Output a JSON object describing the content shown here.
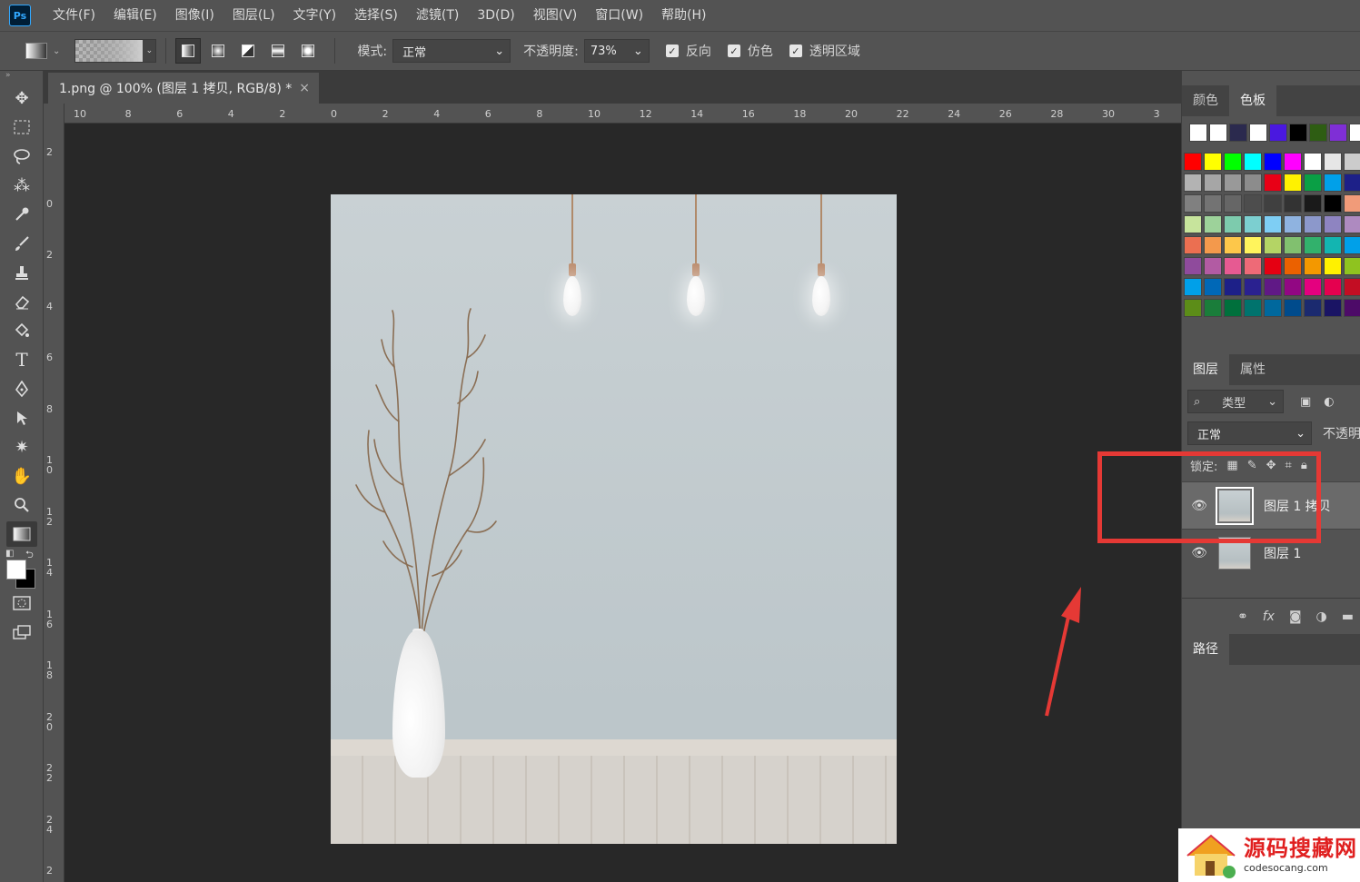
{
  "menubar": {
    "logo": "Ps",
    "items": [
      "文件(F)",
      "编辑(E)",
      "图像(I)",
      "图层(L)",
      "文字(Y)",
      "选择(S)",
      "滤镜(T)",
      "3D(D)",
      "视图(V)",
      "窗口(W)",
      "帮助(H)"
    ]
  },
  "options": {
    "mode_label": "模式:",
    "mode_value": "正常",
    "opacity_label": "不透明度:",
    "opacity_value": "73%",
    "reverse_label": "反向",
    "dither_label": "仿色",
    "transparency_label": "透明区域"
  },
  "document": {
    "tab_title": "1.png @ 100% (图层 1 拷贝, RGB/8) *",
    "close_glyph": "×",
    "h_ruler": [
      "10",
      "8",
      "6",
      "4",
      "2",
      "0",
      "2",
      "4",
      "6",
      "8",
      "10",
      "12",
      "14",
      "16",
      "18",
      "20",
      "22",
      "24",
      "26",
      "28",
      "30",
      "3"
    ],
    "v_ruler": [
      "2",
      "0",
      "2",
      "4",
      "6",
      "8",
      "10",
      "12",
      "14",
      "16",
      "18",
      "20",
      "22",
      "24",
      "2"
    ]
  },
  "swatch_panel": {
    "tabs": [
      "颜色",
      "色板"
    ],
    "active": "色板",
    "rows": [
      [
        "#ffffff",
        "#ffffff",
        "#2b2a4e",
        "#ffffff",
        "#4a18e0",
        "#000000",
        "#2e5d13",
        "#7f2fd6",
        "#ffffff"
      ],
      [
        "#ff0000",
        "#ffff00",
        "#00ff00",
        "#00ffff",
        "#0000ff",
        "#ff00ff",
        "#ffffff",
        "#e6e6e6",
        "#cccccc"
      ],
      [
        "#b3b3b3",
        "#a6a6a6",
        "#999999",
        "#8c8c8c",
        "#e80016",
        "#fff200",
        "#0a9f45",
        "#00a0e9",
        "#1d2088"
      ],
      [
        "#808080",
        "#737373",
        "#666666",
        "#4d4d4d",
        "#404040",
        "#333333",
        "#1a1a1a",
        "#000000",
        "#f19b79"
      ],
      [
        "#c7e49c",
        "#9dd29a",
        "#7dcbad",
        "#7ccfd0",
        "#7ecef4",
        "#8fb3e0",
        "#8c98cb",
        "#8e84c1",
        "#ae8ac0"
      ],
      [
        "#eb6f51",
        "#f3994c",
        "#fdc74a",
        "#fff45c",
        "#b4d465",
        "#81c06f",
        "#32b16c",
        "#13b5b1",
        "#00a0e9"
      ],
      [
        "#8f4b9c",
        "#b25ba3",
        "#e65a92",
        "#ee6a77",
        "#e50012",
        "#eb6100",
        "#f39800",
        "#fff100",
        "#8fc31f"
      ],
      [
        "#00a0e9",
        "#0068b7",
        "#1d2088",
        "#2a2190",
        "#601986",
        "#920783",
        "#e4007f",
        "#e5004f",
        "#c30d23"
      ],
      [
        "#5c8d18",
        "#1a7d3a",
        "#00703c",
        "#00736d",
        "#00689d",
        "#004b8c",
        "#1b2a6f",
        "#1a1464",
        "#4d0b68"
      ]
    ]
  },
  "layers_panel": {
    "tabs": [
      "图层",
      "属性"
    ],
    "filter_label": "类型",
    "blend": "正常",
    "opacity_label": "不透明",
    "lock_label": "锁定:",
    "layers": [
      {
        "name": "图层 1 拷贝",
        "selected": true
      },
      {
        "name": "图层 1",
        "selected": false
      }
    ],
    "footer_fx": "fx"
  },
  "paths_panel": {
    "tab": "路径"
  },
  "watermark": {
    "name": "源码搜藏网",
    "url": "codesocang.com"
  },
  "colors": {
    "highlight": "#e53935",
    "panel_bg": "#535353",
    "canvas_bg": "#282828",
    "photo_wall": "#c3cbce"
  }
}
